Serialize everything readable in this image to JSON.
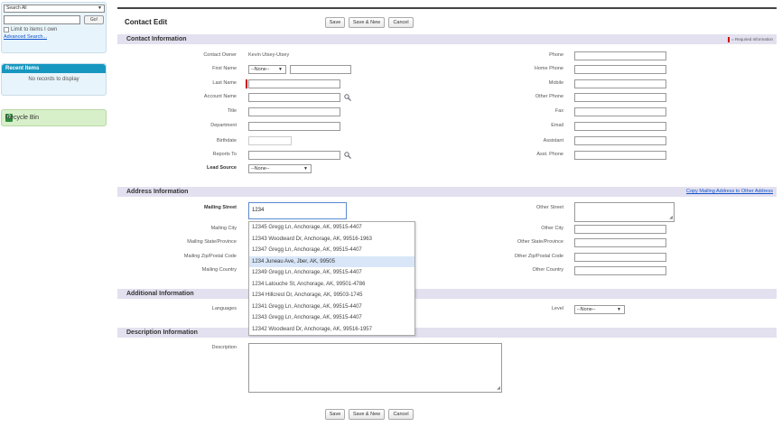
{
  "sidebar": {
    "search_scope": "Search All",
    "go_label": "Go!",
    "limit_label": "Limit to items I own",
    "advanced_search": "Advanced Search...",
    "recent_title": "Recent Items",
    "recent_empty": "No records to display",
    "recycle_bin": "Recycle Bin"
  },
  "page": {
    "title": "Contact Edit",
    "buttons": {
      "save": "Save",
      "save_new": "Save & New",
      "cancel": "Cancel"
    }
  },
  "contact_info": {
    "title": "Contact Information",
    "required_info": "= Required Information",
    "left": {
      "owner_label": "Contact Owner",
      "owner_value": "Kevin Utsey-Utsey",
      "first_name_label": "First Name",
      "salutation_value": "--None--",
      "last_name_label": "Last Name",
      "account_name_label": "Account Name",
      "title_label": "Title",
      "department_label": "Department",
      "birthdate_label": "Birthdate",
      "reports_to_label": "Reports To",
      "lead_source_label": "Lead Source",
      "lead_source_value": "--None--"
    },
    "right": {
      "phone_label": "Phone",
      "home_phone_label": "Home Phone",
      "mobile_label": "Mobile",
      "other_phone_label": "Other Phone",
      "fax_label": "Fax",
      "email_label": "Email",
      "assistant_label": "Assistant",
      "asst_phone_label": "Asst. Phone"
    }
  },
  "address": {
    "title": "Address Information",
    "copy_link": "Copy Mailing Address to Other Address",
    "mailing_street_label": "Mailing Street",
    "mailing_street_value": "1234",
    "mailing_city_label": "Mailing City",
    "mailing_state_label": "Mailing State/Province",
    "mailing_zip_label": "Mailing Zip/Postal Code",
    "mailing_country_label": "Mailing Country",
    "other_street_label": "Other Street",
    "other_city_label": "Other City",
    "other_state_label": "Other State/Province",
    "other_zip_label": "Other Zip/Postal Code",
    "other_country_label": "Other Country"
  },
  "autocomplete": [
    "12345 Gregg Ln, Anchorage, AK, 99515-4407",
    "12343 Woodward Dr, Anchorage, AK, 99516-1963",
    "12347 Gregg Ln, Anchorage, AK, 99515-4407",
    "1234 Juneau Ave, Jber, AK, 99505",
    "12349 Gregg Ln, Anchorage, AK, 99515-4407",
    "1234 Latouche St, Anchorage, AK, 99501-4786",
    "1234 Hillcrest Dr, Anchorage, AK, 99503-1745",
    "12341 Gregg Ln, Anchorage, AK, 99515-4407",
    "12343 Gregg Ln, Anchorage, AK, 99515-4407",
    "12342 Woodward Dr, Anchorage, AK, 99516-1957"
  ],
  "autocomplete_highlighted_index": 3,
  "additional": {
    "title": "Additional Information",
    "languages_label": "Languages",
    "level_label": "Level",
    "level_value": "--None--"
  },
  "description": {
    "title": "Description Information",
    "description_label": "Description"
  },
  "colors": {
    "section_header": "#e3e0ef",
    "required_bar": "#cc0000",
    "recent_header": "#1797c0",
    "recycle_bg": "#d7f0c9",
    "highlight": "#d8e6f8",
    "link": "#1155cc"
  },
  "icons": {
    "lookup": "magnifier-lookup-icon",
    "recycle": "recycle-bin-icon",
    "dropdown": "chevron-down-icon"
  }
}
